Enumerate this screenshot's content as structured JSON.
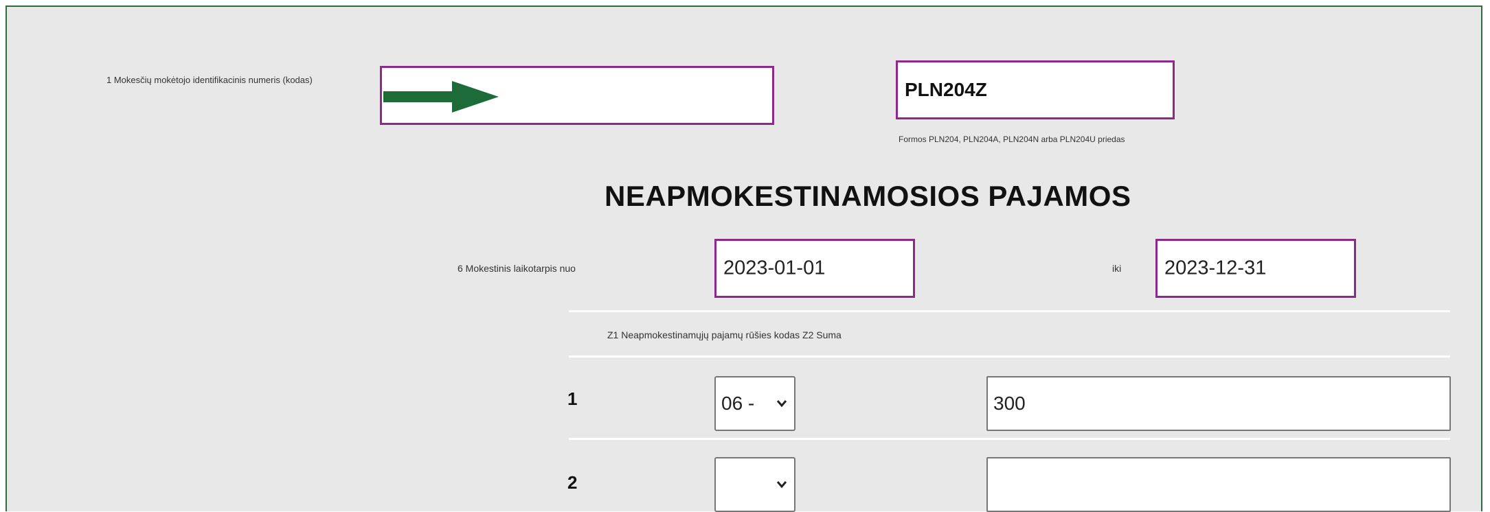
{
  "header": {
    "id_label": "1 Mokesčių mokėtojo identifikacinis numeris (kodas)",
    "form_code": "PLN204Z",
    "form_note": "Formos PLN204, PLN204A, PLN204N arba PLN204U priedas"
  },
  "title": "NEAPMOKESTINAMOSIOS PAJAMOS",
  "period": {
    "label": "6 Mokestinis laikotarpis nuo",
    "from": "2023-01-01",
    "to_label": "iki",
    "to": "2023-12-31"
  },
  "table": {
    "header": "Z1 Neapmokestinamųjų pajamų rūšies kodas Z2 Suma",
    "rows": [
      {
        "num": "1",
        "code": "06 -",
        "amount": "300"
      },
      {
        "num": "2",
        "code": "",
        "amount": ""
      }
    ]
  },
  "colors": {
    "border_accent": "#8b2a8b",
    "arrow": "#1e6b3a",
    "frame": "#2f6b3c"
  },
  "icons": {
    "pointer": "arrow-right-icon",
    "dropdown": "chevron-down-icon"
  }
}
